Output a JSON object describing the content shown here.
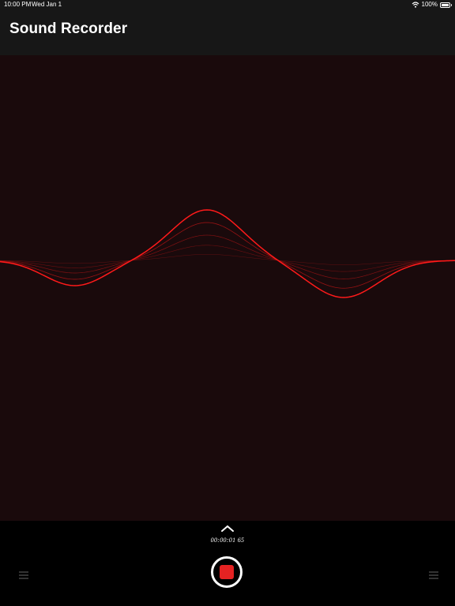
{
  "status_bar": {
    "time": "10:00 PM",
    "date": "Wed Jan 1",
    "battery": "100%",
    "wifi_icon": "wifi-icon",
    "battery_icon": "battery-icon"
  },
  "header": {
    "title": "Sound Recorder"
  },
  "waveform": {
    "color": "#ff1a1a",
    "background": "#1a0a0c"
  },
  "controls": {
    "timer": "00:00:01 65",
    "expand_icon": "chevron-up-icon",
    "left_icon": "list-icon",
    "right_icon": "list-icon",
    "record_icon": "stop-icon",
    "stop_color": "#e52222"
  }
}
